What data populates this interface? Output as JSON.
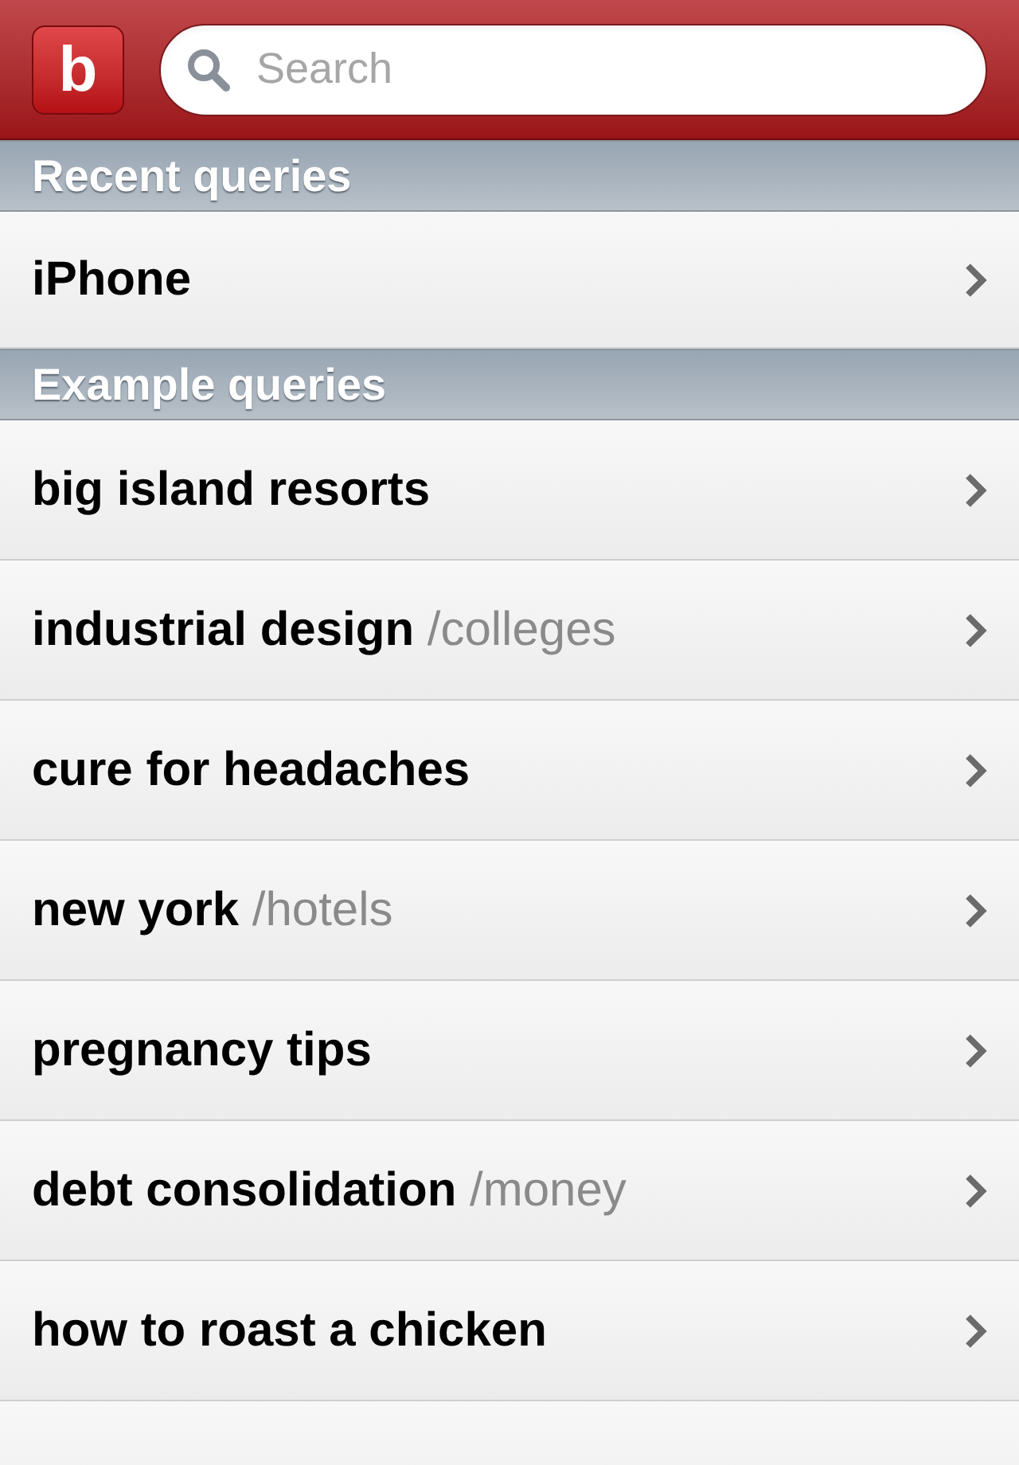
{
  "header": {
    "logo": "b",
    "search": {
      "placeholder": "Search"
    }
  },
  "sections": [
    {
      "title": "Recent queries",
      "items": [
        {
          "query": "iPhone"
        }
      ]
    },
    {
      "title": "Example queries",
      "items": [
        {
          "query": "big island resorts"
        },
        {
          "query": "industrial design",
          "category": "/colleges"
        },
        {
          "query": "cure for headaches"
        },
        {
          "query": "new york",
          "category": "/hotels"
        },
        {
          "query": "pregnancy tips"
        },
        {
          "query": "debt consolidation",
          "category": "/money"
        },
        {
          "query": "how to roast a chicken"
        }
      ]
    }
  ]
}
